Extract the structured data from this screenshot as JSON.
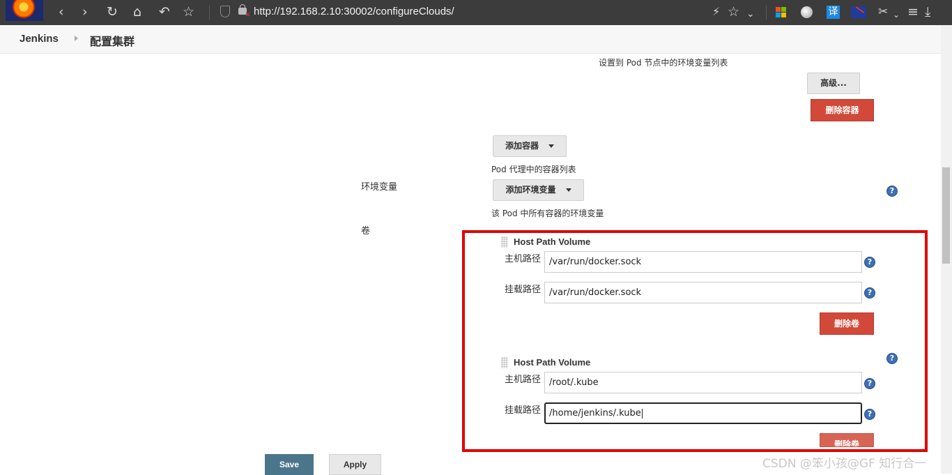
{
  "browser": {
    "url": "http://192.168.2.10:30002/configureClouds/"
  },
  "breadcrumb": {
    "root": "Jenkins",
    "page": "配置集群"
  },
  "form": {
    "env_hint_top": "设置到 Pod 节点中的环境变量列表",
    "advanced_button": "高级...",
    "delete_container_button": "删除容器",
    "add_container_button": "添加容器",
    "container_list_hint": "Pod 代理中的容器列表",
    "env_label": "环境变量",
    "add_env_button": "添加环境变量",
    "env_hint": "该 Pod 中所有容器的环境变量",
    "volumes_label": "卷",
    "volumes": [
      {
        "title": "Host Path Volume",
        "host_path_label": "主机路径",
        "host_path_value": "/var/run/docker.sock",
        "mount_path_label": "挂载路径",
        "mount_path_value": "/var/run/docker.sock",
        "delete_button": "删除卷"
      },
      {
        "title": "Host Path Volume",
        "host_path_label": "主机路径",
        "host_path_value": "/root/.kube",
        "mount_path_label": "挂载路径",
        "mount_path_value": "/home/jenkins/.kube",
        "delete_button": "删除卷"
      }
    ],
    "help_glyph": "?"
  },
  "actions": {
    "save": "Save",
    "apply": "Apply"
  },
  "watermark": "CSDN @笨小孩@GF 知行合一",
  "colors": {
    "danger": "#d24939",
    "save": "#4b758b",
    "help": "#3d6fb4",
    "highlight_box": "#e00000"
  }
}
